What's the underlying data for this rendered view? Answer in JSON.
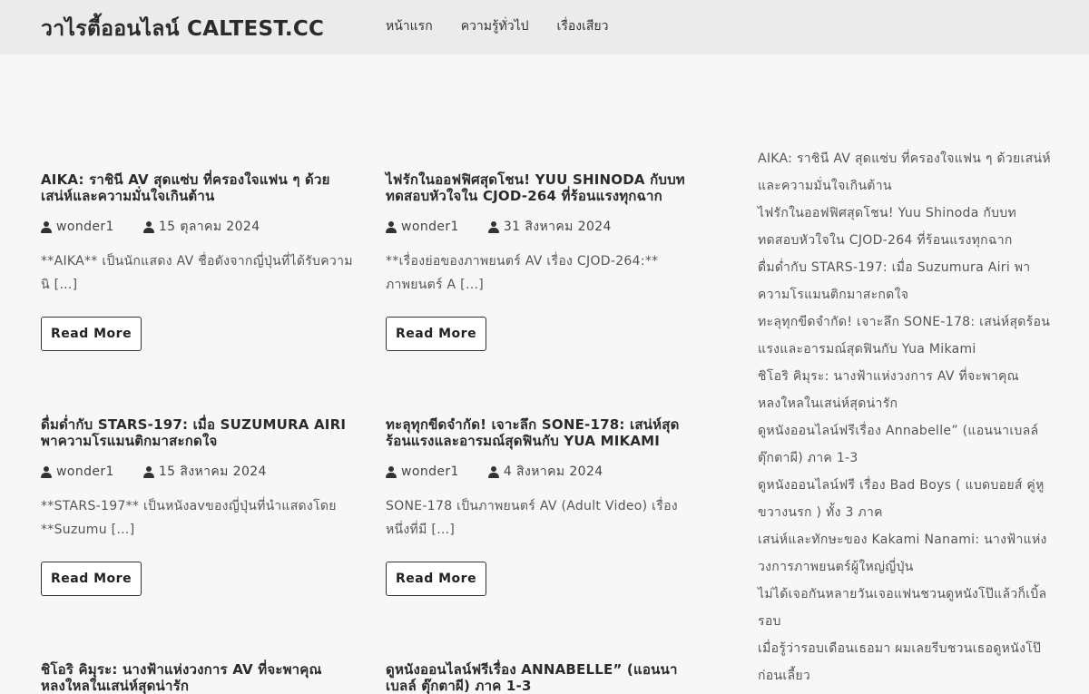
{
  "header": {
    "site_title": "วาไรตี้ออนไลน์ CALTEST.CC",
    "nav": [
      "หน้าแรก",
      "ความรู้ทั่วไป",
      "เรื่องเสียว"
    ]
  },
  "posts": [
    {
      "title": "AIKA: ราชินี AV สุดแซ่บ ที่ครองใจแฟน ๆ ด้วยเสน่ห์และความมั่นใจเกินต้าน",
      "author": "wonder1",
      "date": "15 ตุลาคม 2024",
      "excerpt": "**AIKA** เป็นนักแสดง AV ชื่อดังจากญี่ปุ่นที่ได้รับความนิ […]",
      "read_more": "Read More"
    },
    {
      "title": "ไฟรักในออฟฟิศสุดโชน! YUU SHINODA กับบททดสอบหัวใจใน CJOD-264 ที่ร้อนแรงทุกฉาก",
      "author": "wonder1",
      "date": "31 สิงหาคม 2024",
      "excerpt": "**เรื่องย่อของภาพยนตร์ AV เรื่อง CJOD-264:** ภาพยนตร์ A […]",
      "read_more": "Read More"
    },
    {
      "title": "ดื่มด่ำกับ STARS-197: เมื่อ SUZUMURA AIRI พาความโรแมนติกมาสะกดใจ",
      "author": "wonder1",
      "date": "15 สิงหาคม 2024",
      "excerpt": "**STARS-197** เป็นหนังavของญี่ปุ่นที่นำแสดงโดย **Suzumu […]",
      "read_more": "Read More"
    },
    {
      "title": "ทะลุทุกขีดจำกัด! เจาะลึก SONE-178: เสน่ห์สุดร้อนแรงและอารมณ์สุดฟินกับ YUA MIKAMI",
      "author": "wonder1",
      "date": "4 สิงหาคม 2024",
      "excerpt": "SONE-178 เป็นภาพยนตร์ AV (Adult Video) เรื่องหนึ่งที่มี […]",
      "read_more": "Read More"
    },
    {
      "title": "ชิโอริ คิมุระ: นางฟ้าแห่งวงการ AV ที่จะพาคุณหลงใหลในเสน่ห์สุดน่ารัก"
    },
    {
      "title": "ดูหนังออนไลน์ฟรีเรื่อง ANNABELLE” (แอนนาเบลล์ ตุ๊กตาผี) ภาค 1-3"
    }
  ],
  "sidebar": {
    "links": [
      "AIKA: ราชินี AV สุดแซ่บ ที่ครองใจแฟน ๆ ด้วยเสน่ห์และความมั่นใจเกินต้าน",
      "ไฟรักในออฟฟิศสุดโชน! Yuu Shinoda กับบททดสอบหัวใจใน CJOD-264 ที่ร้อนแรงทุกฉาก",
      "ดื่มด่ำกับ STARS-197: เมื่อ Suzumura Airi พาความโรแมนติกมาสะกดใจ",
      "ทะลุทุกขีดจำกัด! เจาะลึก SONE-178: เสน่ห์สุดร้อนแรงและอารมณ์สุดฟินกับ Yua Mikami",
      "ชิโอริ คิมุระ: นางฟ้าแห่งวงการ AV ที่จะพาคุณหลงใหลในเสน่ห์สุดน่ารัก",
      "ดูหนังออนไลน์ฟรีเรื่อง Annabelle” (แอนนาเบลล์ ตุ๊กตาผี)  ภาค 1-3",
      "ดูหนังออนไลน์ฟรี เรื่อง Bad Boys ( แบดบอยส์ คู่หูขวางนรก ) ทั้ง 3 ภาค",
      "เสน่ห์และทักษะของ Kakami Nanami: นางฟ้าแห่งวงการภาพยนตร์ผู้ใหญ่ญี่ปุ่น",
      "ไม่ได้เจอกันหลายวันเจอแฟนชวนดูหนังโป๊แล้วก็เบิ้ลรอบ",
      "เมื่อรู้ว่ารอบเดือนเธอมา ผมเลยรีบชวนเธอดูหนังโป๊ก่อนเลี้ยว"
    ]
  }
}
